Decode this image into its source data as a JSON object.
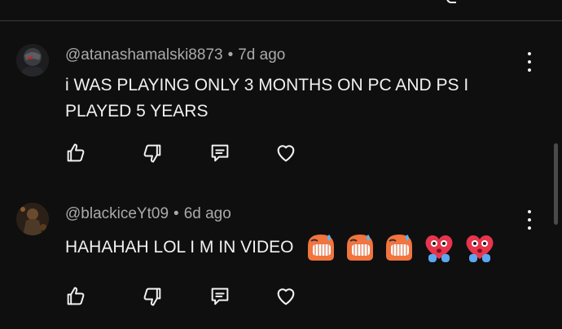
{
  "comments": [
    {
      "author": "@atanashamalski8873",
      "separator": "•",
      "time": "7d ago",
      "text": "i WAS PLAYING ONLY 3 MONTHS ON PC AND PS I PLAYED 5 YEARS",
      "emojis": []
    },
    {
      "author": "@blackiceYt09",
      "separator": "•",
      "time": "6d ago",
      "text": "HAHAHAH LOL I M IN VIDEO",
      "emojis": [
        "grimacing-sweat-emoji",
        "grimacing-sweat-emoji",
        "grimacing-sweat-emoji",
        "heart-hug-emoji",
        "heart-hug-emoji"
      ]
    }
  ],
  "colors": {
    "background": "#0f0f0f",
    "text": "#f1f1f1",
    "meta": "#aaaaaa"
  },
  "icons": [
    "thumbs-up-icon",
    "thumbs-down-icon",
    "reply-icon",
    "heart-icon",
    "more-vert-icon"
  ]
}
